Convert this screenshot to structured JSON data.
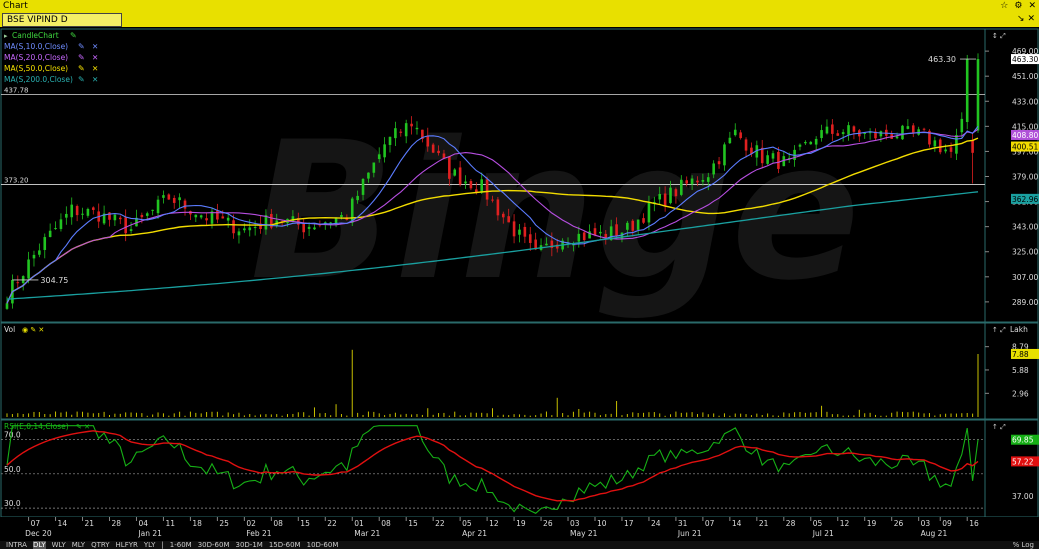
{
  "window": {
    "title": "Chart",
    "controls": [
      "☆",
      "⚙",
      "✕"
    ]
  },
  "symbol_bar": {
    "symbol": "BSE VIPIND D",
    "controls": "↘ ✕"
  },
  "studies": [
    {
      "label": "CandleChart",
      "color": "#3fd63f"
    },
    {
      "label": "MA(S,10.0,Close)",
      "color": "#6f8cff"
    },
    {
      "label": "MA(S,20.0,Close)",
      "color": "#c868ff"
    },
    {
      "label": "MA(S,50.0,Close)",
      "color": "#f4e000"
    },
    {
      "label": "MA(S,200.0,Close)",
      "color": "#2ab0b0"
    }
  ],
  "vol_legend": "Vol",
  "rsi_legend": "RSI(E,0,14,Close)",
  "lakh_label": "Lakh",
  "colors": {
    "up": "#21c421",
    "down": "#e02020",
    "ma10": "#5b7cff",
    "ma20": "#b64ee0",
    "ma50": "#f2dc00",
    "ma200": "#1aa0a0",
    "vol": "#c8c000",
    "rsi": "#16b016",
    "rsi_signal": "#e01010"
  },
  "watermark": "Binge",
  "bottom_bar": {
    "items": [
      "INTRA",
      "DLY",
      "WLY",
      "MLY",
      "QTRY",
      "HLFYR",
      "YLY",
      "|",
      "1-60M",
      "30D-60M",
      "30D-1M",
      "15D-60M",
      "10D-60M"
    ],
    "selected": "DLY",
    "right": "% Log"
  },
  "chart_data": [
    {
      "type": "candlestick",
      "panel": "price",
      "y_ticks": [
        "469.00",
        "451.00",
        "433.00",
        "415.00",
        "397.00",
        "379.00",
        "361.00",
        "343.00",
        "325.00",
        "307.00",
        "289.00"
      ],
      "ylim": [
        276,
        482
      ],
      "hlines": [
        437.78,
        373.2
      ],
      "labels": {
        "high_line": "437.78",
        "low_line": "373.20",
        "min_point": "304.75",
        "peak": "463.30"
      },
      "price_tags": [
        {
          "value": 463.3,
          "text": "463.30",
          "bg": "#ffffff",
          "fg": "#000000"
        },
        {
          "value": 408.8,
          "text": "408.80",
          "bg": "#b050d8",
          "fg": "#ffffff"
        },
        {
          "value": 400.51,
          "text": "400.51",
          "bg": "#f2dc00",
          "fg": "#000000"
        },
        {
          "value": 362.96,
          "text": "362.96",
          "bg": "#1aa0a0",
          "fg": "#000000"
        }
      ],
      "x_ticks": [
        "07",
        "14",
        "21",
        "28",
        "04",
        "11",
        "18",
        "25",
        "02",
        "08",
        "15",
        "22",
        "01",
        "08",
        "15",
        "22",
        "05",
        "12",
        "19",
        "26",
        "03",
        "10",
        "17",
        "24",
        "31",
        "07",
        "14",
        "21",
        "28",
        "05",
        "12",
        "19",
        "26",
        "03",
        "09",
        "16"
      ],
      "x_tick_index": [
        4,
        9,
        14,
        19,
        24,
        29,
        34,
        39,
        44,
        49,
        54,
        59,
        64,
        69,
        74,
        79,
        84,
        89,
        94,
        99,
        104,
        109,
        114,
        119,
        124,
        129,
        134,
        139,
        144,
        149,
        154,
        159,
        164,
        169,
        173,
        178
      ],
      "months": [
        {
          "label": "Dec 20",
          "index": 3
        },
        {
          "label": "Jan 21",
          "index": 24
        },
        {
          "label": "Feb 21",
          "index": 44
        },
        {
          "label": "Mar 21",
          "index": 64
        },
        {
          "label": "Apr 21",
          "index": 84
        },
        {
          "label": "May 21",
          "index": 104
        },
        {
          "label": "Jun 21",
          "index": 124
        },
        {
          "label": "Jul 21",
          "index": 149
        },
        {
          "label": "Aug 21",
          "index": 169
        }
      ],
      "n_sessions": 181,
      "anchors": [
        [
          0,
          294
        ],
        [
          6,
          328
        ],
        [
          12,
          355
        ],
        [
          17,
          352
        ],
        [
          23,
          341
        ],
        [
          30,
          364
        ],
        [
          37,
          350
        ],
        [
          44,
          341
        ],
        [
          50,
          349
        ],
        [
          55,
          343
        ],
        [
          63,
          351
        ],
        [
          70,
          402
        ],
        [
          75,
          418
        ],
        [
          82,
          382
        ],
        [
          88,
          371
        ],
        [
          93,
          345
        ],
        [
          98,
          322
        ],
        [
          103,
          336
        ],
        [
          110,
          337
        ],
        [
          115,
          341
        ],
        [
          120,
          359
        ],
        [
          125,
          371
        ],
        [
          130,
          382
        ],
        [
          135,
          410
        ],
        [
          140,
          393
        ],
        [
          145,
          388
        ],
        [
          150,
          409
        ],
        [
          155,
          412
        ],
        [
          160,
          408
        ],
        [
          165,
          410
        ],
        [
          170,
          408
        ],
        [
          175,
          396
        ],
        [
          177,
          415
        ],
        [
          178,
          463.3
        ]
      ],
      "ma200": {
        "start": 291,
        "end": 368,
        "dip": 282
      }
    },
    {
      "type": "bar",
      "panel": "volume",
      "unit": "Lakh",
      "y_ticks": [
        "8.79",
        "5.88",
        "2.96"
      ],
      "ylim": [
        0,
        11
      ],
      "last_tag": {
        "value": 7.88,
        "text": "7.88"
      }
    },
    {
      "type": "line",
      "panel": "rsi",
      "y_ticks_left": [
        "70.0",
        "50.0",
        "30.0"
      ],
      "y_ticks_right": [
        "37.00"
      ],
      "ylim": [
        26,
        79
      ],
      "guides": [
        70,
        50,
        30
      ],
      "tags": [
        {
          "value": 69.85,
          "text": "69.85",
          "bg": "#16b016"
        },
        {
          "value": 57.22,
          "text": "57.22",
          "bg": "#e01010"
        }
      ]
    }
  ]
}
